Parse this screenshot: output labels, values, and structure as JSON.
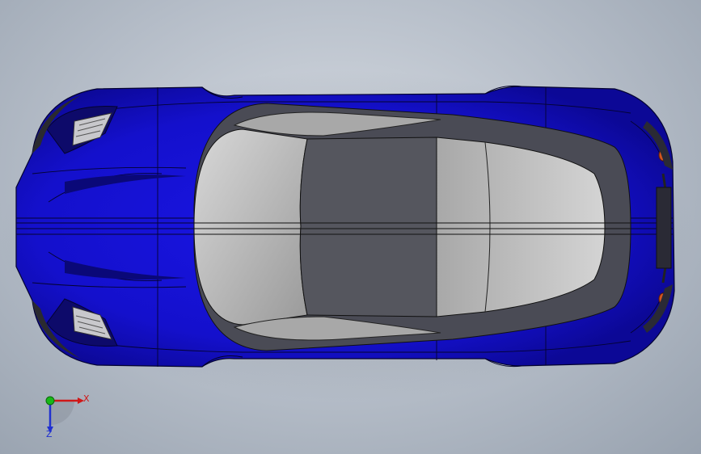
{
  "viewport": {
    "background_colors": [
      "#d6dbe2",
      "#98a2af"
    ]
  },
  "model": {
    "body_color": "#1a10d8",
    "glass_color": "#b4b4b4",
    "roof_color": "#55565e",
    "light_color": "#d2551e"
  },
  "triad": {
    "x_label": "X",
    "z_label": "Z",
    "x_color": "#d01818",
    "y_color": "#18b818",
    "z_color": "#2030d0"
  }
}
